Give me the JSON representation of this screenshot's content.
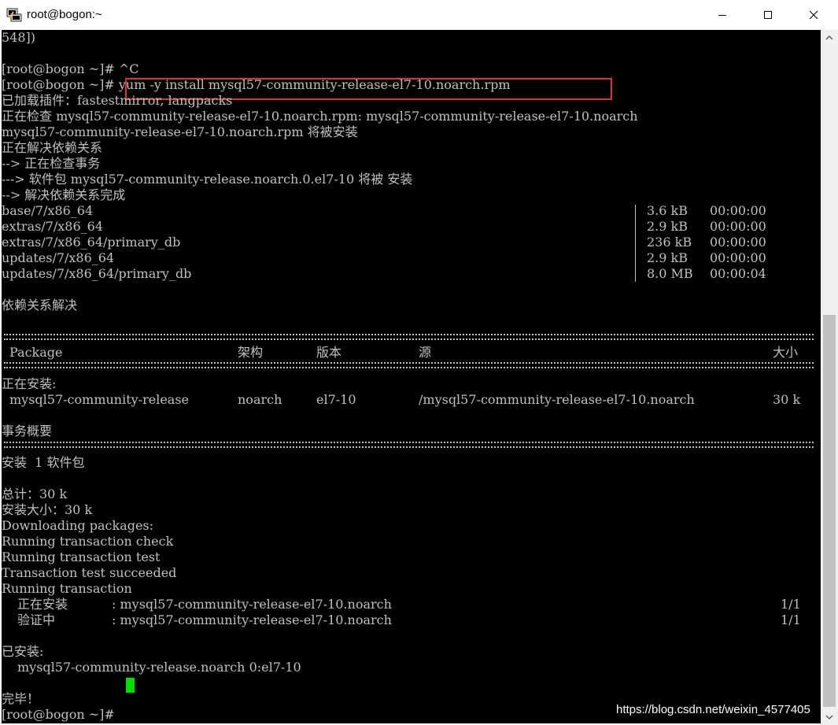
{
  "window": {
    "title": "root@bogon:~",
    "icons": {
      "app": "putty-terminal-icon",
      "minimize": "minimize-icon",
      "maximize": "maximize-icon",
      "close": "close-icon"
    }
  },
  "terminal": {
    "line_01": "548])",
    "line_02": "",
    "line_03": "[root@bogon ~]# ^C",
    "line_04_prompt": "[root@bogon ~]# ",
    "line_04_command": "yum -y install mysql57-community-release-el7-10.noarch.rpm",
    "line_05": "已加载插件：fastestmirror, langpacks",
    "line_06": "正在检查 mysql57-community-release-el7-10.noarch.rpm: mysql57-community-release-el7-10.noarch",
    "line_07": "mysql57-community-release-el7-10.noarch.rpm 将被安装",
    "line_08": "正在解决依赖关系",
    "line_09": "--> 正在检查事务",
    "line_10": "---> 软件包 mysql57-community-release.noarch.0.el7-10 将被 安装",
    "line_11": "--> 解决依赖关系完成",
    "repos": [
      {
        "name": "base/7/x86_64",
        "size": "3.6 kB",
        "time": "00:00:00"
      },
      {
        "name": "extras/7/x86_64",
        "size": "2.9 kB",
        "time": "00:00:00"
      },
      {
        "name": "extras/7/x86_64/primary_db",
        "size": "236 kB",
        "time": "00:00:00"
      },
      {
        "name": "updates/7/x86_64",
        "size": "2.9 kB",
        "time": "00:00:00"
      },
      {
        "name": "updates/7/x86_64/primary_db",
        "size": "8.0 MB",
        "time": "00:00:04"
      }
    ],
    "deps_resolved": "依赖关系解决",
    "table_headers": {
      "package": "Package",
      "arch": "架构",
      "version": "版本",
      "repo": "源",
      "size": "大小"
    },
    "installing_label": "正在安装:",
    "package_row": {
      "package": "mysql57-community-release",
      "arch": "noarch",
      "version": "el7-10",
      "repo": "/mysql57-community-release-el7-10.noarch",
      "size": "30 k"
    },
    "summary_label": "事务概要",
    "install_count": "安装  1 软件包",
    "total": "总计：30 k",
    "install_size": "安装大小：30 k",
    "log_1": "Downloading packages:",
    "log_2": "Running transaction check",
    "log_3": "Running transaction test",
    "log_4": "Transaction test succeeded",
    "log_5": "Running transaction",
    "step_installing_label": "正在安装",
    "step_installing_value": ": mysql57-community-release-el7-10.noarch",
    "step_installing_progress": "1/1",
    "step_verify_label": "验证中",
    "step_verify_value": ": mysql57-community-release-el7-10.noarch",
    "step_verify_progress": "1/1",
    "installed_label": "已安装:",
    "installed_package": "mysql57-community-release.noarch 0:el7-10",
    "complete": "完毕！",
    "final_prompt": "[root@bogon ~]# "
  },
  "watermark": "https://blog.csdn.net/weixin_4577405",
  "colors": {
    "terminal_bg": "#000000",
    "terminal_fg": "#c0c0c0",
    "highlight_border": "#e03030",
    "cursor": "#00e000"
  }
}
